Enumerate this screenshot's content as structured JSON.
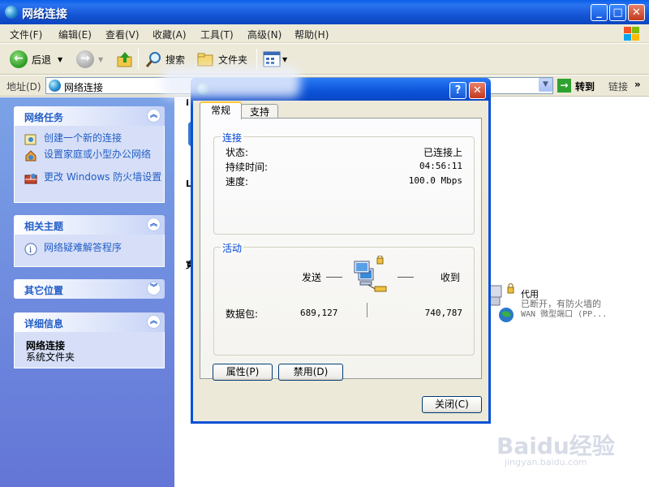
{
  "window": {
    "title": "网络连接"
  },
  "menu": [
    "文件(F)",
    "编辑(E)",
    "查看(V)",
    "收藏(A)",
    "工具(T)",
    "高级(N)",
    "帮助(H)"
  ],
  "toolbar": {
    "back": "后退",
    "search": "搜索",
    "folders": "文件夹"
  },
  "address": {
    "label": "地址(D)",
    "value": "网络连接",
    "go": "转到",
    "links": "链接"
  },
  "left_pane": {
    "network_tasks": {
      "title": "网络任务",
      "items": [
        "创建一个新的连接",
        "设置家庭或小型办公网络",
        "更改 Windows 防火墙设置"
      ]
    },
    "related_topics": {
      "title": "相关主题",
      "items": [
        "网络疑难解答程序"
      ]
    },
    "other_places": {
      "title": "其它位置"
    },
    "details": {
      "title": "详细信息",
      "name": "网络连接",
      "type": "系统文件夹"
    }
  },
  "content": {
    "proxy_name": "代用",
    "proxy_status": "已断开，有防火墙的",
    "proxy_desc": "WAN 微型端口 (PP..."
  },
  "dialog": {
    "tabs": [
      "常规",
      "支持"
    ],
    "connection": {
      "title": "连接",
      "status_label": "状态:",
      "status_value": "已连接上",
      "duration_label": "持续时间:",
      "duration_value": "04:56:11",
      "speed_label": "速度:",
      "speed_value": "100.0 Mbps"
    },
    "activity": {
      "title": "活动",
      "sent_label": "发送",
      "received_label": "收到",
      "packets_label": "数据包:",
      "sent_packets": "689,127",
      "received_packets": "740,787"
    },
    "properties_button": "属性(P)",
    "disable_button": "禁用(D)",
    "close_button": "关闭(C)"
  },
  "watermark": {
    "main": "Baidu经验",
    "sub": "jingyan.baidu.com"
  }
}
